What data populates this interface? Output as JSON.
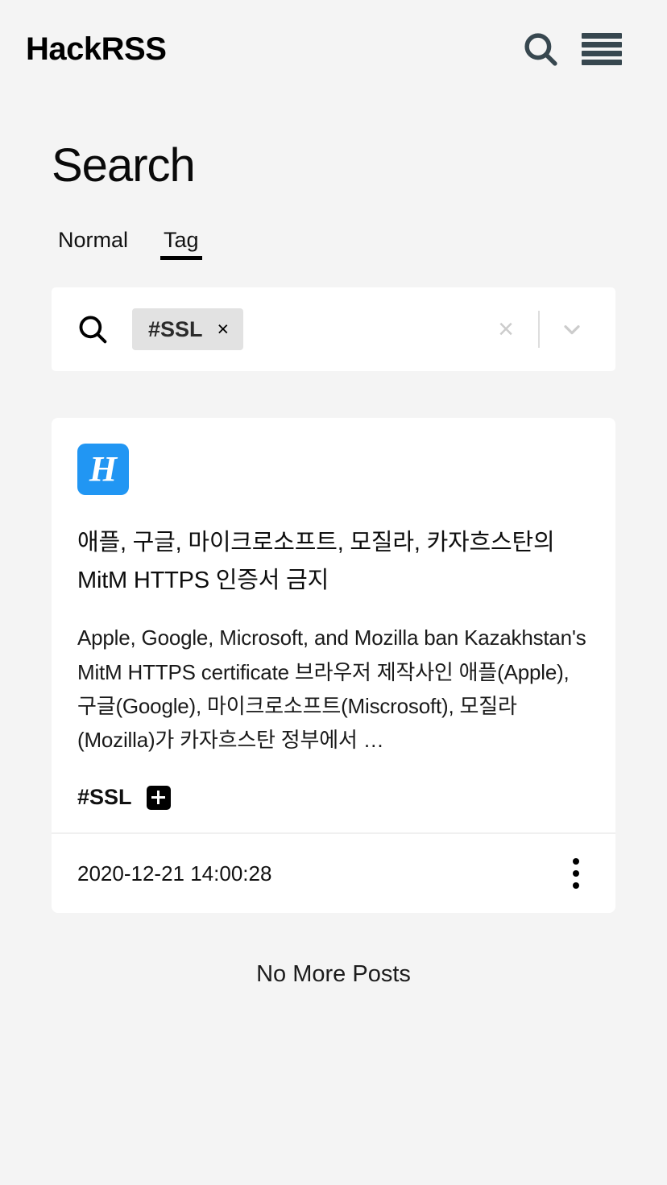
{
  "header": {
    "brand": "HackRSS",
    "search_icon": "search-icon",
    "menu_icon": "hamburger-menu-icon"
  },
  "page": {
    "title": "Search"
  },
  "tabs": [
    {
      "label": "Normal",
      "active": false
    },
    {
      "label": "Tag",
      "active": true
    }
  ],
  "search": {
    "glass_icon": "search-icon",
    "chip": {
      "label": "#SSL",
      "remove": "×"
    },
    "clear": "×",
    "dropdown_icon": "chevron-down-icon"
  },
  "post": {
    "favicon_letter": "H",
    "favicon_color": "#2196f3",
    "title": "애플, 구글, 마이크로소프트, 모질라, 카자흐스탄의 MitM HTTPS 인증서 금지",
    "description": "Apple, Google, Microsoft, and Mozilla ban Kazakhstan's MitM HTTPS certificate   브라우저 제작사인 애플(Apple), 구글(Google), 마이크로소프트(Miscrosoft), 모질라(Mozilla)가 카자흐스탄 정부에서 …",
    "tag": "#SSL",
    "add_tag_icon": "plus-icon",
    "timestamp": "2020-12-21 14:00:28",
    "more_icon": "kebab-menu-icon"
  },
  "footer": {
    "no_more": "No More Posts"
  }
}
